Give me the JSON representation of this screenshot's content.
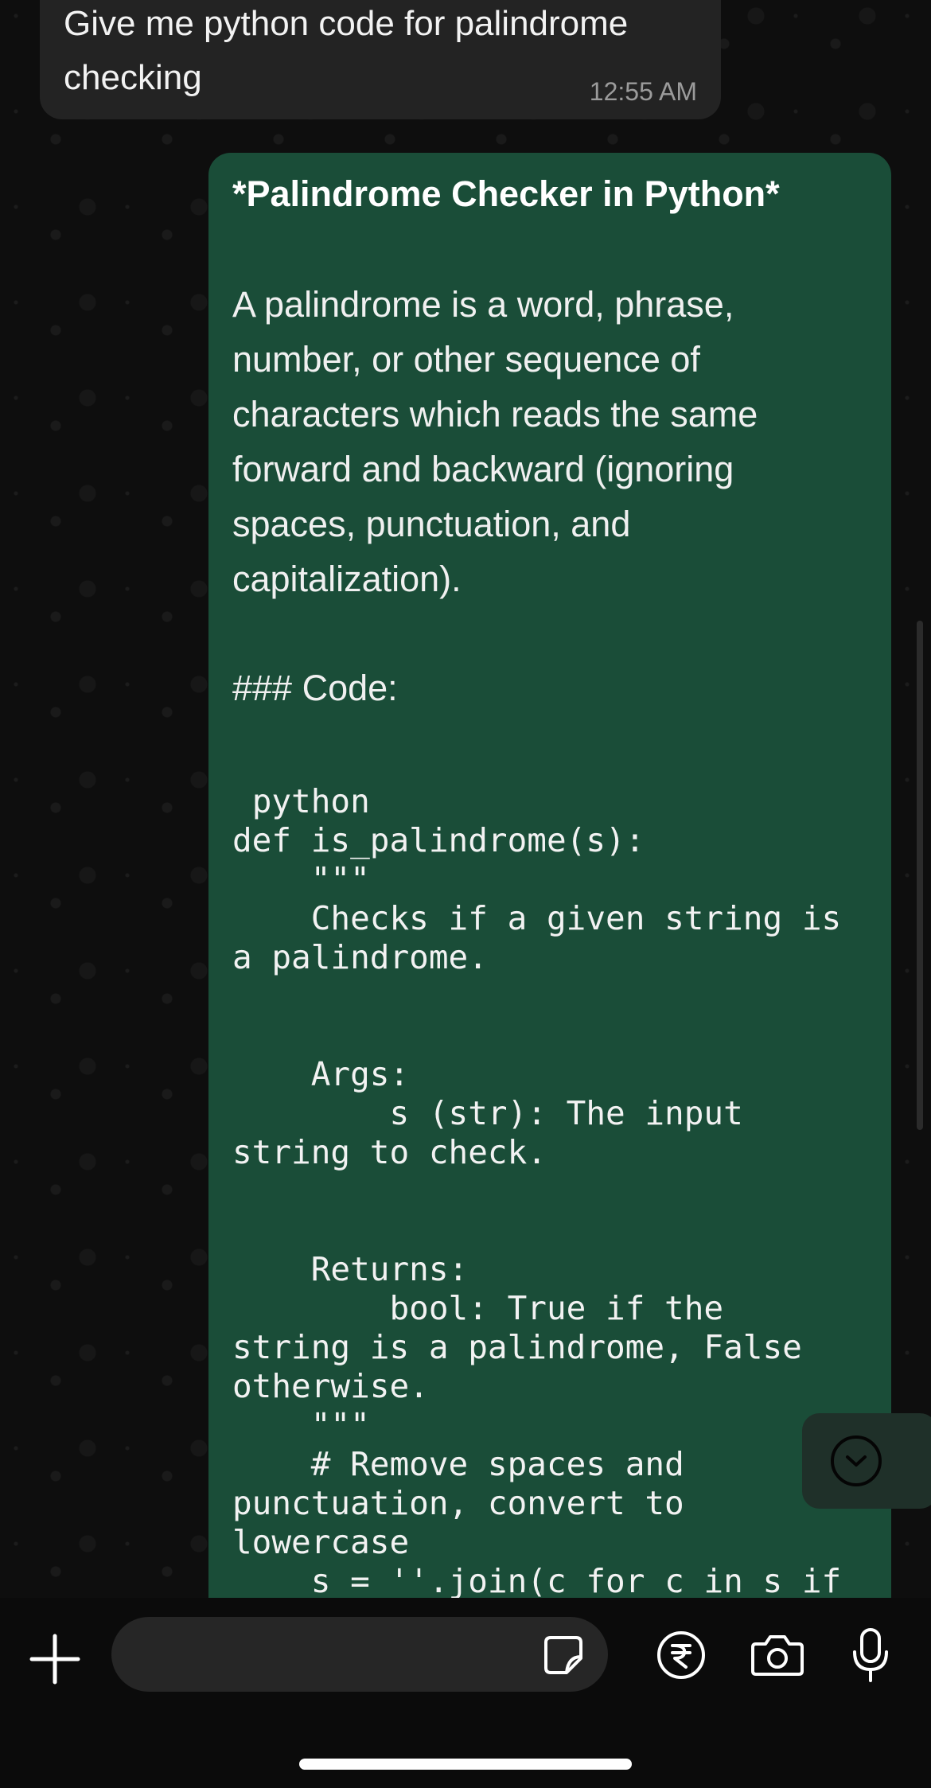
{
  "conversation": {
    "incoming": {
      "text": "Give me python code for palindrome\nchecking",
      "time": "12:55 AM"
    },
    "outgoing": {
      "title": "*Palindrome Checker in Python*",
      "paragraph": "A palindrome is a word, phrase,\nnumber, or other sequence of\ncharacters which reads the same\nforward and backward (ignoring\nspaces, punctuation, and\ncapitalization).",
      "heading": "### Code:",
      "code": " python\ndef is_palindrome(s):\n    \"\"\"\n    Checks if a given string is\na palindrome.\n\n\n    Args:\n        s (str): The input\nstring to check.\n\n\n    Returns:\n        bool: True if the\nstring is a palindrome, False\notherwise.\n    \"\"\"\n    # Remove spaces and\npunctuation, convert to\nlowercase\n    s = ''.join(c for c in s if c.isalnum()).lower()"
    }
  },
  "icons": {
    "scroll_down": "chevron-down-icon",
    "attach": "plus-icon",
    "sticker": "sticker-icon",
    "payment": "rupee-icon",
    "camera": "camera-icon",
    "mic": "microphone-icon"
  },
  "colors": {
    "outgoing_bubble": "#1a4d38",
    "incoming_bubble": "#232323",
    "background": "#0b0b0b"
  }
}
